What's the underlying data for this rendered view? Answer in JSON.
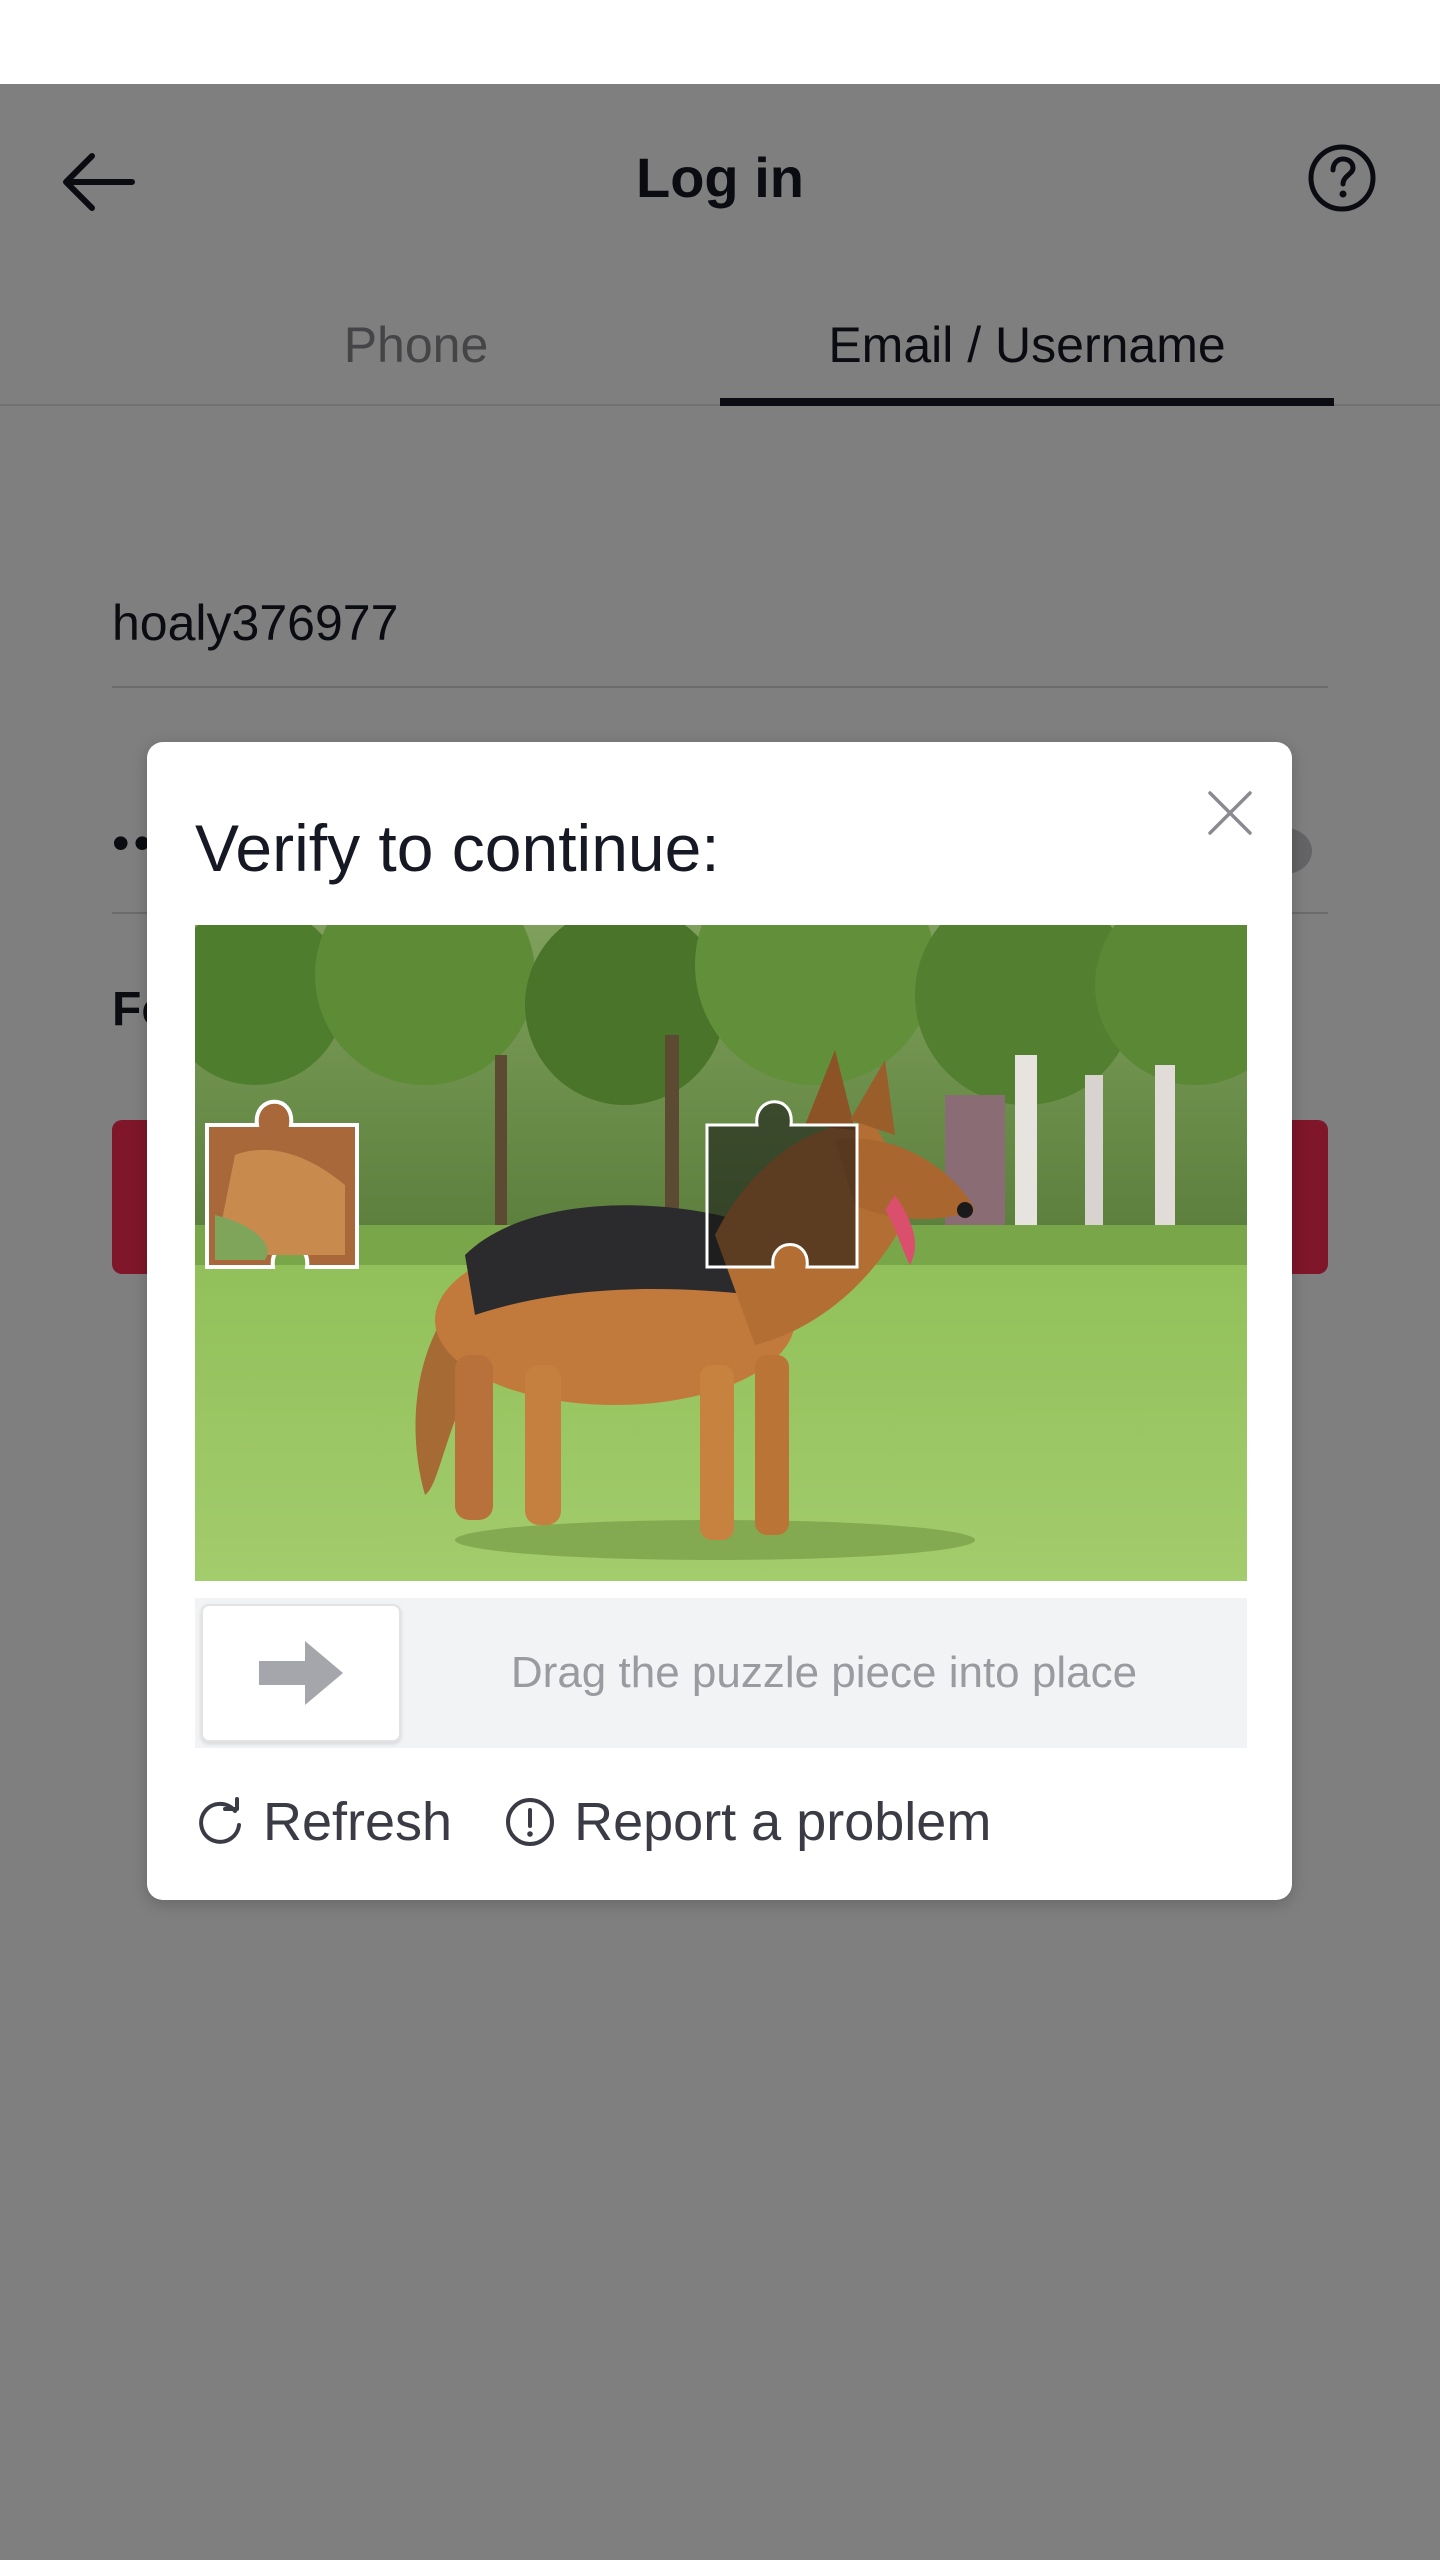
{
  "header": {
    "title": "Log in",
    "back_icon": "arrow-left-icon",
    "help_icon": "question-circle-icon"
  },
  "tabs": [
    {
      "label": "Phone",
      "active": false
    },
    {
      "label": "Email / Username",
      "active": true
    }
  ],
  "form": {
    "username_value": "hoaly376977",
    "password_masked": "••",
    "forgot_label_partial": "Fo",
    "login_button_color": "#fe2c55"
  },
  "captcha": {
    "title": "Verify to continue:",
    "close_icon": "close-icon",
    "slider_hint": "Drag the puzzle piece into place",
    "slider_icon": "arrow-right-icon",
    "refresh_label": "Refresh",
    "refresh_icon": "refresh-icon",
    "report_label": "Report a problem",
    "report_icon": "alert-circle-icon"
  }
}
